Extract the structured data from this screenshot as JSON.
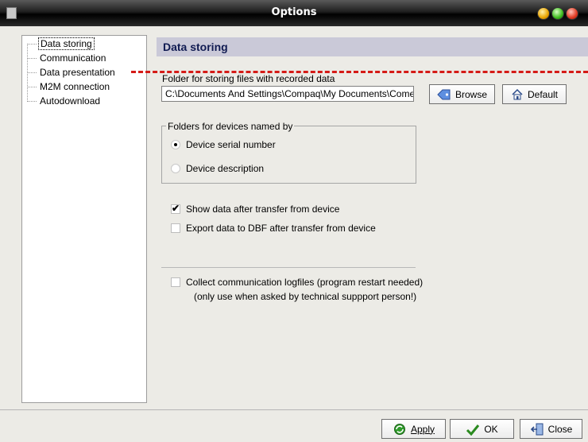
{
  "window": {
    "title": "Options"
  },
  "tree": {
    "items": [
      {
        "label": "Data storing",
        "selected": true
      },
      {
        "label": "Communication",
        "selected": false
      },
      {
        "label": "Data presentation",
        "selected": false
      },
      {
        "label": "M2M connection",
        "selected": false
      },
      {
        "label": "Autodownload",
        "selected": false
      }
    ]
  },
  "panel": {
    "header": "Data storing",
    "folder_label": "Folder for storing files with recorded data",
    "folder_value": "C:\\Documents And Settings\\Compaq\\My Documents\\Comet",
    "browse_label": "Browse",
    "default_label": "Default",
    "group_title": "Folders for devices named by",
    "radio_serial": "Device serial number",
    "radio_description": "Device description",
    "check_show_data": "Show data after transfer from device",
    "check_export_dbf": "Export data to DBF after transfer from device",
    "check_logfiles_line1": "Collect communication logfiles (program restart needed)",
    "check_logfiles_line2": "(only use when asked by technical suppport person!)"
  },
  "state": {
    "radio_serial_selected": true,
    "show_data_checked": true,
    "export_dbf_checked": false,
    "logfiles_checked": false
  },
  "footer": {
    "apply_label": "Apply",
    "ok_label": "OK",
    "close_label": "Close"
  },
  "colors": {
    "header_bg": "#cac9d8",
    "header_text": "#111b52",
    "dashed_line": "#d51b17"
  },
  "icons": {
    "browse": "tag-icon",
    "default": "home-icon",
    "apply": "refresh-icon",
    "ok": "checkmark-icon",
    "close": "exit-door-icon"
  }
}
